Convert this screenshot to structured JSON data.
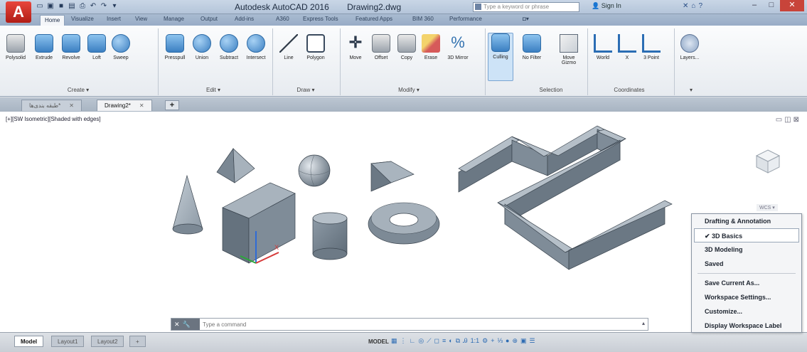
{
  "app": {
    "title": "Autodesk AutoCAD 2016",
    "filename": "Drawing2.dwg",
    "logo_letter": "A",
    "search_placeholder": "Type a keyword or phrase",
    "signin": "Sign In"
  },
  "ribbon_tabs": [
    {
      "label": "Home",
      "active": true
    },
    {
      "label": "Visualize"
    },
    {
      "label": "Insert"
    },
    {
      "label": "View"
    },
    {
      "label": "Manage"
    },
    {
      "label": "Output"
    },
    {
      "label": "Add-ins"
    },
    {
      "label": "A360"
    },
    {
      "label": "Express Tools"
    },
    {
      "label": "Featured Apps"
    },
    {
      "label": "BIM 360"
    },
    {
      "label": "Performance"
    }
  ],
  "ribbon": {
    "create": {
      "label": "Create ▾",
      "buttons": [
        "Polysolid",
        "Extrude",
        "Revolve",
        "Loft",
        "Sweep"
      ]
    },
    "edit": {
      "label": "Edit ▾",
      "buttons": [
        "Presspull",
        "Union",
        "Subtract",
        "Intersect"
      ]
    },
    "draw": {
      "label": "Draw ▾",
      "buttons": [
        "Line",
        "Polygon"
      ]
    },
    "modify": {
      "label": "Modify ▾",
      "buttons": [
        "Move",
        "Offset",
        "Copy",
        "Erase",
        "3D Mirror"
      ]
    },
    "selection": {
      "label": "Selection",
      "buttons": [
        "Culling",
        "No Filter",
        "Move Gizmo"
      ]
    },
    "coordinates": {
      "label": "Coordinates",
      "buttons": [
        "World",
        "X",
        "3 Point"
      ]
    },
    "layers": {
      "label": "Layers..."
    }
  },
  "doc_tabs": [
    {
      "label": "طبقه بندی‌ها*",
      "active": false
    },
    {
      "label": "Drawing2*",
      "active": true
    }
  ],
  "viewport": {
    "label": "[+][SW Isometric][Shaded with edges]",
    "wcs": "WCS"
  },
  "workspace_menu": {
    "items": [
      {
        "label": "Drafting & Annotation",
        "checked": false
      },
      {
        "label": "3D Basics",
        "checked": true
      },
      {
        "label": "3D Modeling",
        "checked": false
      },
      {
        "label": "Saved",
        "checked": false
      }
    ],
    "actions": [
      "Save Current As...",
      "Workspace Settings...",
      "Customize...",
      "Display Workspace Label"
    ]
  },
  "command_line": {
    "placeholder": "Type a command"
  },
  "status_bar": {
    "tabs": [
      {
        "label": "Model",
        "active": true
      },
      {
        "label": "Layout1"
      },
      {
        "label": "Layout2"
      }
    ],
    "model_label": "MODEL",
    "scale": "1:1"
  },
  "colors": {
    "accent": "#3b7fc2",
    "logo_red": "#c8281e",
    "solid_gray": "#7d8a96"
  }
}
